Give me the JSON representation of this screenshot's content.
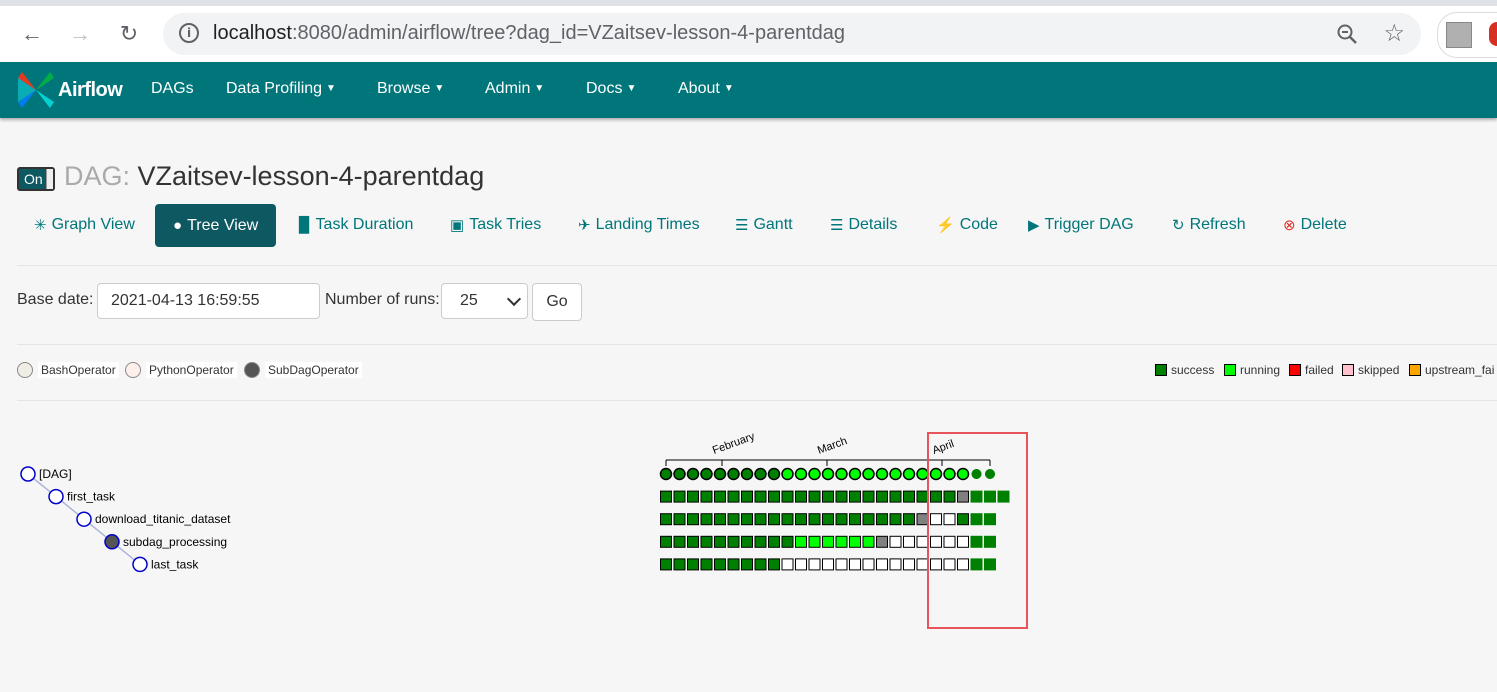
{
  "browser": {
    "url_host": "localhost",
    "url_rest": ":8080/admin/airflow/tree?dag_id=VZaitsev-lesson-4-parentdag"
  },
  "navbar": {
    "brand": "Airflow",
    "items": [
      {
        "label": "DAGs",
        "dropdown": false
      },
      {
        "label": "Data Profiling",
        "dropdown": true
      },
      {
        "label": "Browse",
        "dropdown": true
      },
      {
        "label": "Admin",
        "dropdown": true
      },
      {
        "label": "Docs",
        "dropdown": true
      },
      {
        "label": "About",
        "dropdown": true
      }
    ],
    "color": "#00767b"
  },
  "dag": {
    "toggle_label": "On",
    "title_prefix": "DAG:",
    "title": "VZaitsev-lesson-4-parentdag"
  },
  "tabs": [
    {
      "label": "Graph View",
      "icon": "asterisk-icon"
    },
    {
      "label": "Tree View",
      "icon": "tree-icon",
      "active": true
    },
    {
      "label": "Task Duration",
      "icon": "bar-chart-icon"
    },
    {
      "label": "Task Tries",
      "icon": "files-icon"
    },
    {
      "label": "Landing Times",
      "icon": "plane-icon"
    },
    {
      "label": "Gantt",
      "icon": "align-left-icon"
    },
    {
      "label": "Details",
      "icon": "list-icon"
    },
    {
      "label": "Code",
      "icon": "flash-icon"
    },
    {
      "label": "Trigger DAG",
      "icon": "play-circle-icon"
    },
    {
      "label": "Refresh",
      "icon": "refresh-icon"
    },
    {
      "label": "Delete",
      "icon": "remove-circle-icon"
    }
  ],
  "form": {
    "base_date_label": "Base date:",
    "base_date_value": "2021-04-13 16:59:55",
    "num_runs_label": "Number of runs:",
    "num_runs_value": "25",
    "go_label": "Go"
  },
  "operators": [
    {
      "label": "BashOperator",
      "color": "#f0ede4"
    },
    {
      "label": "PythonOperator",
      "color": "#ffefeb"
    },
    {
      "label": "SubDagOperator",
      "color": "#555555"
    }
  ],
  "states": [
    {
      "label": "success",
      "color": "#008000"
    },
    {
      "label": "running",
      "color": "#00ff00"
    },
    {
      "label": "failed",
      "color": "#ff0000"
    },
    {
      "label": "skipped",
      "color": "#ffc0cb"
    },
    {
      "label": "upstream_fai",
      "color": "#ffa500"
    }
  ],
  "tree": {
    "nodes": [
      {
        "label": "[DAG]",
        "depth": 0,
        "filled": false
      },
      {
        "label": "first_task",
        "depth": 1,
        "filled": false
      },
      {
        "label": "download_titanic_dataset",
        "depth": 2,
        "filled": false
      },
      {
        "label": "subdag_processing",
        "depth": 3,
        "filled": true
      },
      {
        "label": "last_task",
        "depth": 4,
        "filled": false
      }
    ],
    "months": [
      "February",
      "March",
      "April"
    ],
    "runs": "GGGGGGGGGLLLLLLLLLLLLLLdd",
    "rows": [
      "GGGGGGGGGGGGGGGGGGGGGGdGGG",
      "GGGGGGGGGGGGGGGGGGGdwwGGG",
      "GGGGGGGGGGLLLLLLdwwwwwwGG",
      "GGGGGGGGGwwwwwwwwwwwwwwGG"
    ]
  }
}
